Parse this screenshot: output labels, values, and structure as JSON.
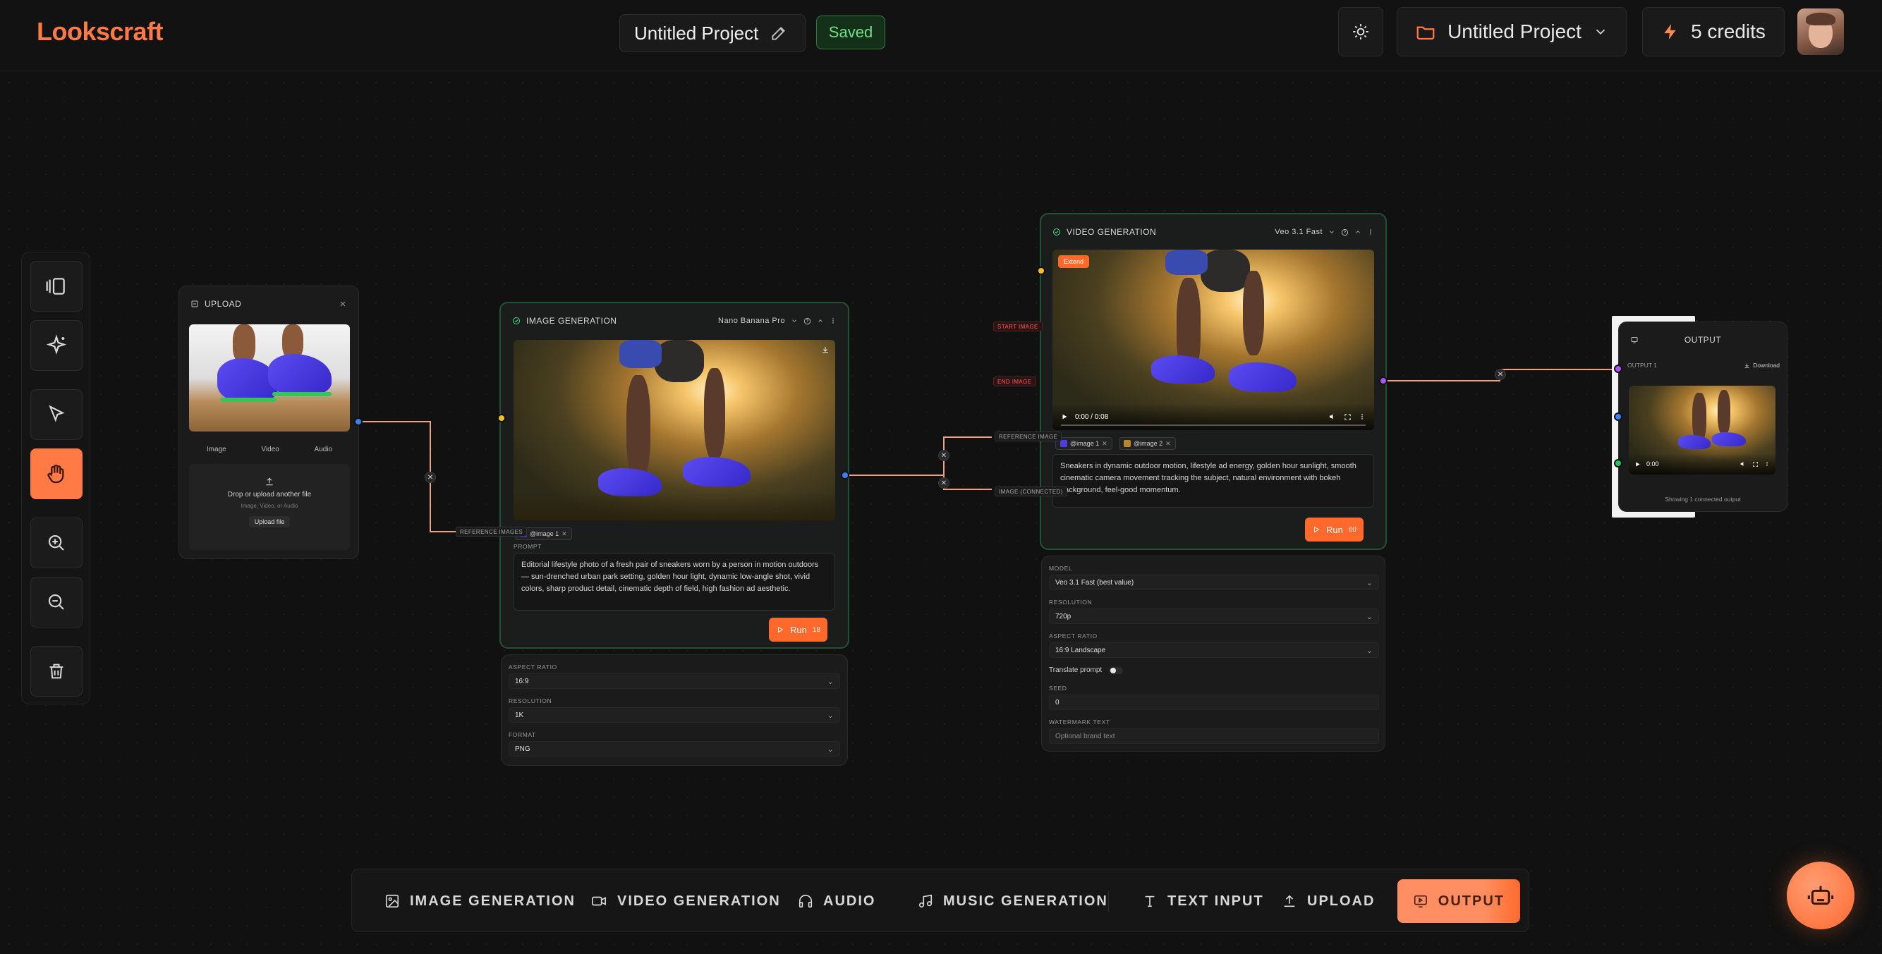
{
  "app": {
    "logo": "Lookscraft",
    "project_title": "Untitled Project",
    "saved_label": "Saved",
    "project_menu_label": "Untitled Project",
    "credits_label": "5 credits"
  },
  "colors": {
    "accent": "#ff7a45",
    "saved_green": "#6ee089",
    "port_blue": "#3b82f6",
    "port_yellow": "#f5c21b",
    "port_purple": "#a855f7",
    "port_green": "#22c55e"
  },
  "upload_node": {
    "title": "UPLOAD",
    "tabs": [
      "Image",
      "Video",
      "Audio"
    ],
    "drop_text": "Drop or upload another file",
    "drop_sub": "Image, Video, or Audio",
    "upload_button": "Upload file"
  },
  "image_gen_node": {
    "title": "IMAGE GENERATION",
    "model": "Nano Banana Pro",
    "reference_label": "REFERENCE IMAGES",
    "ref_tag": "@image 1",
    "prompt_label": "PROMPT",
    "prompt": "Editorial lifestyle photo of a fresh pair of sneakers worn by a person in motion outdoors — sun-drenched urban park setting, golden hour light, dynamic low-angle shot, vivid colors, sharp product detail, cinematic depth of field, high fashion ad aesthetic.",
    "run_label": "Run",
    "run_cost": "18",
    "settings": [
      {
        "label": "ASPECT RATIO",
        "value": "16:9"
      },
      {
        "label": "RESOLUTION",
        "value": "1K"
      },
      {
        "label": "FORMAT",
        "value": "PNG"
      }
    ]
  },
  "video_gen_node": {
    "title": "VIDEO GENERATION",
    "model": "Veo 3.1 Fast",
    "extend_badge": "Extend",
    "time": "0:00 / 0:08",
    "start_image_label": "START IMAGE",
    "end_image_label": "END IMAGE",
    "reference_label": "REFERENCE IMAGE",
    "image_connected_label": "IMAGE (CONNECTED)",
    "ref_tags": [
      "@image 1",
      "@image 2"
    ],
    "prompt": "Sneakers in dynamic outdoor motion, lifestyle ad energy, golden hour sunlight, smooth cinematic camera movement tracking the subject, natural environment with bokeh background, feel-good momentum.",
    "run_label": "Run",
    "run_cost": "60",
    "settings": [
      {
        "label": "MODEL",
        "value": "Veo 3.1 Fast (best value)"
      },
      {
        "label": "RESOLUTION",
        "value": "720p"
      },
      {
        "label": "ASPECT RATIO",
        "value": "16:9 Landscape"
      }
    ],
    "translate_label": "Translate prompt",
    "seed_label": "SEED",
    "seed_value": "0",
    "watermark_label": "WATERMARK TEXT",
    "watermark_placeholder": "Optional brand text"
  },
  "output_node": {
    "title": "OUTPUT",
    "item_label": "OUTPUT 1",
    "download_label": "Download",
    "time": "0:00",
    "footer": "Showing 1 connected output"
  },
  "bottom_bar": {
    "items": [
      {
        "label": "IMAGE GENERATION",
        "icon": "image-icon"
      },
      {
        "label": "VIDEO GENERATION",
        "icon": "video-icon"
      },
      {
        "label": "AUDIO",
        "icon": "headphones-icon"
      },
      {
        "label": "MUSIC GENERATION",
        "icon": "music-note-icon"
      },
      {
        "label": "TEXT INPUT",
        "icon": "text-icon"
      },
      {
        "label": "UPLOAD",
        "icon": "upload-icon"
      },
      {
        "label": "OUTPUT",
        "icon": "output-icon"
      }
    ]
  }
}
